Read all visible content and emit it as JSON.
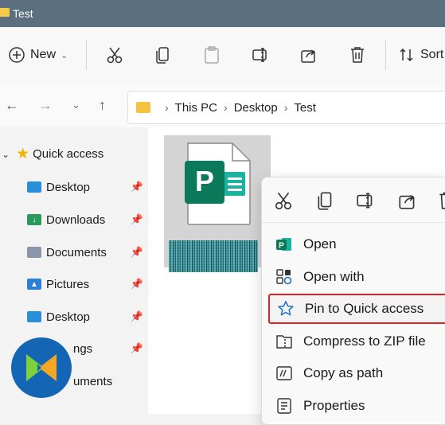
{
  "window": {
    "title": "Test"
  },
  "toolbar": {
    "new_label": "New",
    "sort_label": "Sort"
  },
  "address": {
    "crumbs": [
      "This PC",
      "Desktop",
      "Test"
    ]
  },
  "sidebar": {
    "quick_access": "Quick access",
    "items": [
      {
        "label": "Desktop",
        "icon": "desktop-folder-icon"
      },
      {
        "label": "Downloads",
        "icon": "downloads-folder-icon"
      },
      {
        "label": "Documents",
        "icon": "documents-folder-icon"
      },
      {
        "label": "Pictures",
        "icon": "pictures-folder-icon"
      },
      {
        "label": "Desktop",
        "icon": "desktop-folder-icon"
      },
      {
        "label": "ngs",
        "icon": "folder-icon"
      },
      {
        "label": "uments",
        "icon": "folder-icon"
      }
    ]
  },
  "context_menu": {
    "items": [
      {
        "label": "Open",
        "icon": "publisher-icon"
      },
      {
        "label": "Open with",
        "icon": "open-with-icon"
      },
      {
        "label": "Pin to Quick access",
        "icon": "star-icon",
        "highlighted": true
      },
      {
        "label": "Compress to ZIP file",
        "icon": "zip-icon"
      },
      {
        "label": "Copy as path",
        "icon": "copy-path-icon"
      },
      {
        "label": "Properties",
        "icon": "properties-icon"
      }
    ]
  },
  "colors": {
    "titlebar": "#5b6f7e",
    "highlight_border": "#e0202a",
    "publisher_green": "#0b7a5a",
    "accent_blue": "#1a6fc4"
  }
}
